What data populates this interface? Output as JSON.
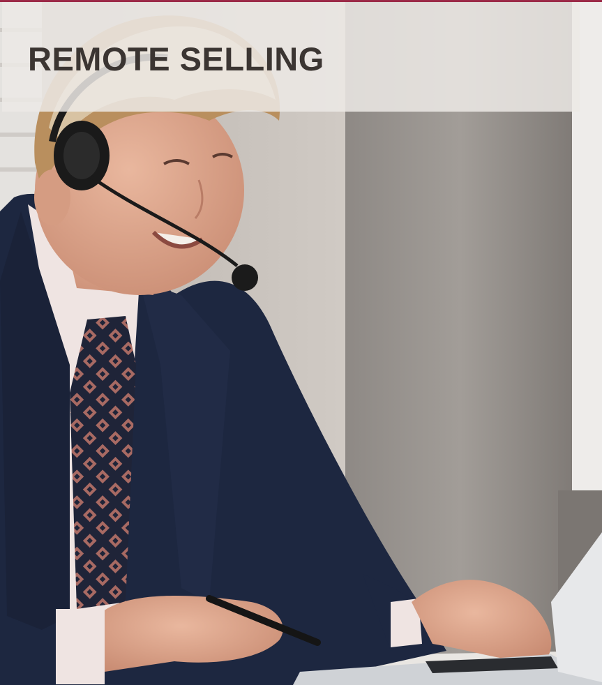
{
  "header": {
    "title": "REMOTE SELLING",
    "accent_color": "#9c2a48",
    "title_color": "#3b3532"
  },
  "photo": {
    "icon": "businessman-headset-laptop-photo"
  }
}
